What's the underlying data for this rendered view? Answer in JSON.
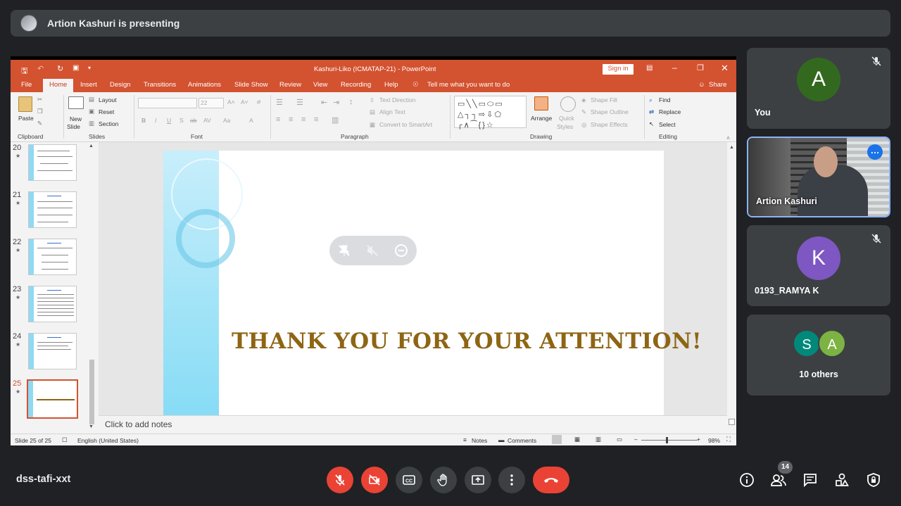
{
  "presenter_banner": {
    "text": "Artion Kashuri is presenting"
  },
  "powerpoint": {
    "window_title": "Kashuri-Liko (ICMATAP-21)  -  PowerPoint",
    "sign_in": "Sign in",
    "tabs": [
      "File",
      "Home",
      "Insert",
      "Design",
      "Transitions",
      "Animations",
      "Slide Show",
      "Review",
      "View",
      "Recording",
      "Help"
    ],
    "tell_me": "Tell me what you want to do",
    "share": "Share",
    "ribbon": {
      "clipboard": {
        "paste": "Paste",
        "group": "Clipboard"
      },
      "slides": {
        "new_slide": "New",
        "new_slide2": "Slide",
        "layout": "Layout",
        "reset": "Reset",
        "section": "Section",
        "group": "Slides"
      },
      "font": {
        "size": "22",
        "group": "Font"
      },
      "paragraph": {
        "text_direction": "Text Direction",
        "align_text": "Align Text",
        "convert_smartart": "Convert to SmartArt",
        "group": "Paragraph"
      },
      "drawing": {
        "arrange": "Arrange",
        "quick": "Quick",
        "styles": "Styles",
        "shape_fill": "Shape Fill",
        "shape_outline": "Shape Outline",
        "shape_effects": "Shape Effects",
        "group": "Drawing"
      },
      "editing": {
        "find": "Find",
        "replace": "Replace",
        "select": "Select",
        "group": "Editing"
      }
    },
    "thumbnails": [
      {
        "num": "20",
        "current": false
      },
      {
        "num": "21",
        "current": false
      },
      {
        "num": "22",
        "current": false
      },
      {
        "num": "23",
        "current": false
      },
      {
        "num": "24",
        "current": false
      },
      {
        "num": "25",
        "current": true
      }
    ],
    "slide_text": "THANK YOU FOR YOUR ATTENTION!",
    "notes_placeholder": "Click to add notes",
    "status": {
      "slide_counter": "Slide 25 of 25",
      "language": "English (United States)",
      "notes": "Notes",
      "comments": "Comments",
      "zoom": "98%"
    }
  },
  "participants": [
    {
      "name": "You",
      "initial": "A",
      "color": "#33691e",
      "muted": true
    },
    {
      "name": "Artion Kashuri",
      "video": true
    },
    {
      "name": "0193_RAMYA K",
      "initial": "K",
      "color": "#7e57c2",
      "muted": true
    },
    {
      "name": "10 others",
      "initials": [
        "S",
        "A"
      ],
      "colors": [
        "#00897b",
        "#7cb342"
      ]
    }
  ],
  "meeting": {
    "code": "dss-tafi-xxt",
    "participant_count": "14"
  }
}
